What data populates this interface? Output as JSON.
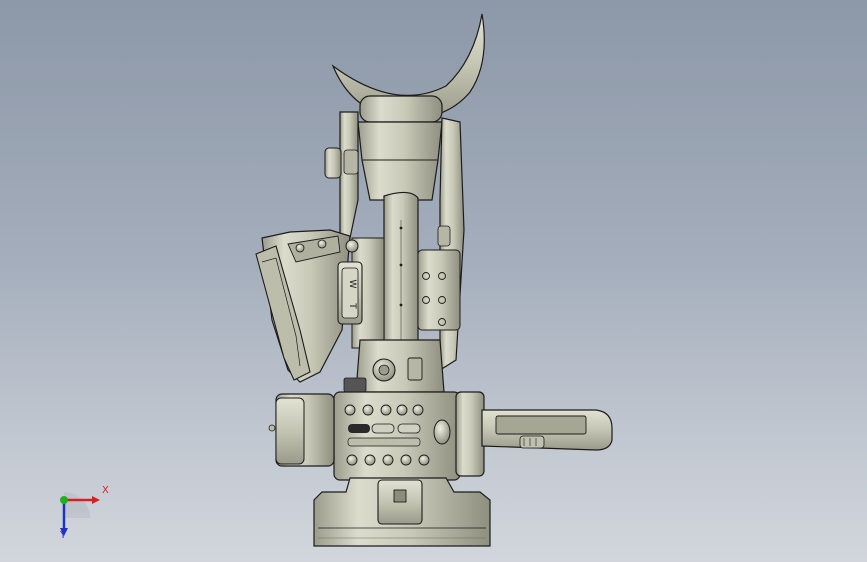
{
  "viewport": {
    "background_top": "#8d98a8",
    "background_bottom": "#d2d6dc"
  },
  "model": {
    "body_color": "#c9c9b8",
    "shade_color": "#a8a897",
    "highlight_color": "#e6e6d8",
    "outline_color": "#1c1c1c",
    "zoom_rocker_labels": {
      "wide": "W",
      "tele": "T"
    }
  },
  "triad": {
    "x_label": "X",
    "y_label": "Y",
    "x_color": "#d82020",
    "y_color": "#2030c0",
    "origin_color": "#20b020"
  }
}
